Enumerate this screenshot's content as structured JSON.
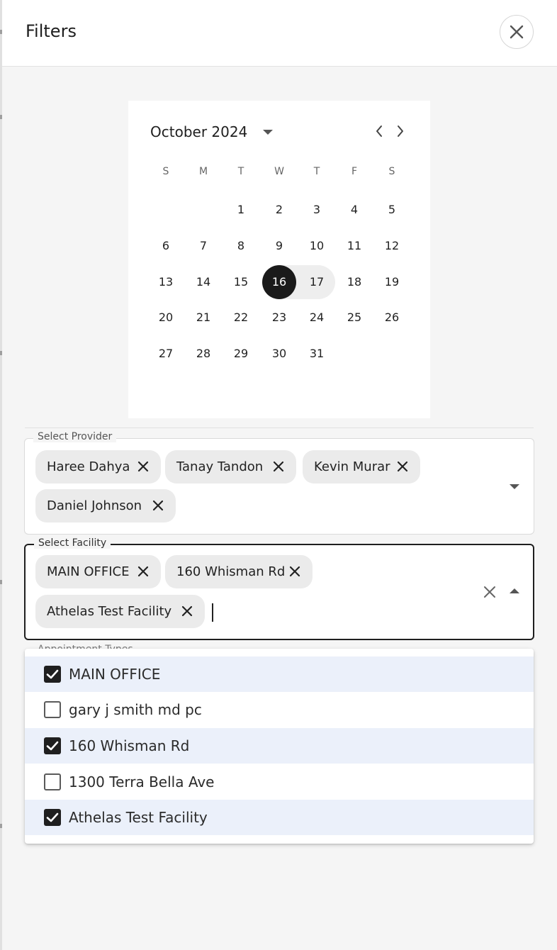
{
  "header": {
    "title": "Filters"
  },
  "calendar": {
    "month_label": "October 2024",
    "weekdays": [
      "S",
      "M",
      "T",
      "W",
      "T",
      "F",
      "S"
    ],
    "days": [
      "1",
      "2",
      "3",
      "4",
      "5",
      "6",
      "7",
      "8",
      "9",
      "10",
      "11",
      "12",
      "13",
      "14",
      "15",
      "16",
      "17",
      "18",
      "19",
      "20",
      "21",
      "22",
      "23",
      "24",
      "25",
      "26",
      "27",
      "28",
      "29",
      "30",
      "31"
    ],
    "selected_day": "16",
    "range_end_day": "17"
  },
  "provider": {
    "label": "Select Provider",
    "chips": [
      "Haree Dahya",
      "Tanay Tandon",
      "Kevin Murar",
      "Daniel Johnson"
    ]
  },
  "facility": {
    "label": "Select Facility",
    "chips": [
      "MAIN OFFICE",
      "160 Whisman Rd",
      "Athelas Test Facility"
    ]
  },
  "appointment_types": {
    "label": "Appointment Types"
  },
  "facility_options": [
    {
      "label": "MAIN OFFICE",
      "checked": true
    },
    {
      "label": "gary j smith md pc",
      "checked": false
    },
    {
      "label": "160 Whisman Rd",
      "checked": true
    },
    {
      "label": "1300 Terra Bella Ave",
      "checked": false
    },
    {
      "label": "Athelas Test Facility",
      "checked": true
    }
  ],
  "icons": {
    "close": "close-icon",
    "prev": "chevron-left-icon",
    "next": "chevron-right-icon",
    "dropdown": "arrow-drop-down-icon",
    "chip_remove": "cancel-icon",
    "check": "check-icon"
  },
  "colors": {
    "selected_day": "#1a1a1a",
    "checked_row": "#ebf0fa",
    "chip": "#ebebeb"
  }
}
